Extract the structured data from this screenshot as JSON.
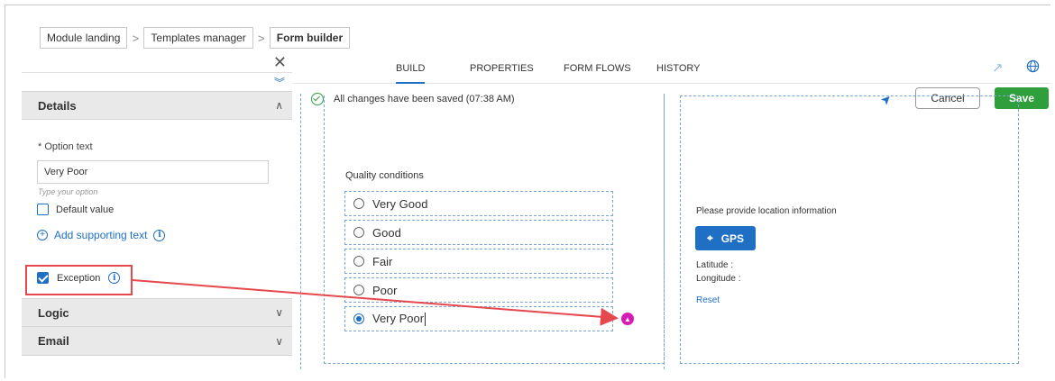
{
  "breadcrumb": {
    "items": [
      "Module landing",
      "Templates manager",
      "Form builder"
    ]
  },
  "left_panel": {
    "close_icon": "close-icon",
    "expand_icon": "double-chevron-down-icon",
    "details": {
      "title": "Details",
      "option_text_label": "* Option text",
      "option_text_value": "Very Poor",
      "option_hint": "Type your option",
      "default_value_label": "Default value",
      "default_value_checked": false,
      "add_supporting_text": "Add supporting text",
      "exception_label": "Exception",
      "exception_checked": true
    },
    "logic_title": "Logic",
    "email_title": "Email"
  },
  "tabs": {
    "items": [
      "BUILD",
      "PROPERTIES",
      "FORM FLOWS",
      "HISTORY"
    ],
    "active": "BUILD"
  },
  "status": {
    "text": "All changes have been saved (07:38 AM)",
    "cancel_label": "Cancel",
    "save_label": "Save"
  },
  "form": {
    "question_label": "Quality conditions",
    "options": [
      "Very Good",
      "Good",
      "Fair",
      "Poor",
      "Very Poor"
    ],
    "selected": "Very Poor"
  },
  "location": {
    "prompt": "Please provide location information",
    "gps_label": "GPS",
    "latitude_label": "Latitude :",
    "longitude_label": "Longitude :",
    "reset_label": "Reset"
  },
  "colors": {
    "accent": "#1f6fc5",
    "save": "#2e9f3b",
    "highlight": "#e5484d",
    "warning": "#d61ab4"
  }
}
